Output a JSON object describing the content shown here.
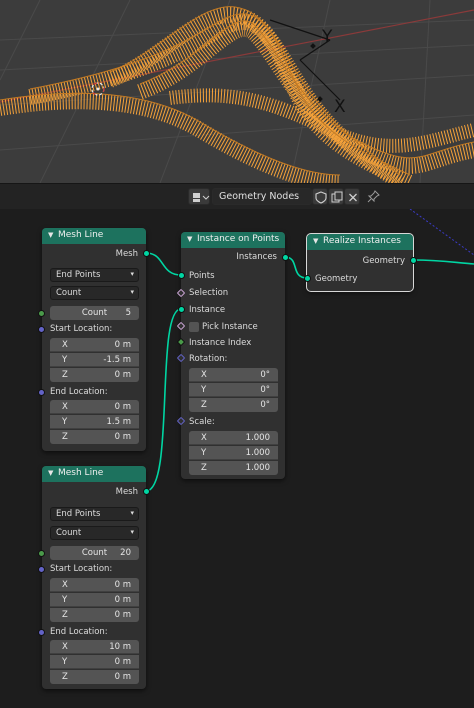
{
  "header": {
    "editor_icon": "node-editor-icon",
    "node_tree_name": "Geometry Nodes",
    "buttons": [
      "shield-icon",
      "duplicate-icon",
      "close-icon",
      "pin-icon"
    ]
  },
  "nodes": {
    "mesh_line_1": {
      "title": "Mesh Line",
      "output": "Mesh",
      "mode": "End Points",
      "count_mode": "Count",
      "count_label": "Count",
      "count_value": "5",
      "start_label": "Start Location:",
      "start": [
        {
          "axis": "X",
          "value": "0 m"
        },
        {
          "axis": "Y",
          "value": "-1.5 m"
        },
        {
          "axis": "Z",
          "value": "0 m"
        }
      ],
      "end_label": "End Location:",
      "end": [
        {
          "axis": "X",
          "value": "0 m"
        },
        {
          "axis": "Y",
          "value": "1.5 m"
        },
        {
          "axis": "Z",
          "value": "0 m"
        }
      ]
    },
    "mesh_line_2": {
      "title": "Mesh Line",
      "output": "Mesh",
      "mode": "End Points",
      "count_mode": "Count",
      "count_label": "Count",
      "count_value": "20",
      "start_label": "Start Location:",
      "start": [
        {
          "axis": "X",
          "value": "0 m"
        },
        {
          "axis": "Y",
          "value": "0 m"
        },
        {
          "axis": "Z",
          "value": "0 m"
        }
      ],
      "end_label": "End Location:",
      "end": [
        {
          "axis": "X",
          "value": "10 m"
        },
        {
          "axis": "Y",
          "value": "0 m"
        },
        {
          "axis": "Z",
          "value": "0 m"
        }
      ]
    },
    "instance_on_points": {
      "title": "Instance on Points",
      "output": "Instances",
      "points": "Points",
      "selection": "Selection",
      "instance": "Instance",
      "pick_instance": "Pick Instance",
      "instance_index": "Instance Index",
      "rotation_label": "Rotation:",
      "rotation": [
        {
          "axis": "X",
          "value": "0°"
        },
        {
          "axis": "Y",
          "value": "0°"
        },
        {
          "axis": "Z",
          "value": "0°"
        }
      ],
      "scale_label": "Scale:",
      "scale": [
        {
          "axis": "X",
          "value": "1.000"
        },
        {
          "axis": "Y",
          "value": "1.000"
        },
        {
          "axis": "Z",
          "value": "1.000"
        }
      ]
    },
    "realize_instances": {
      "title": "Realize Instances",
      "output": "Geometry",
      "input": "Geometry"
    }
  },
  "viewport": {
    "gizmo_labels": [
      "Y",
      "X"
    ],
    "mesh_color": "#f5a23a"
  },
  "colors": {
    "node_header": "#1d725e",
    "geometry_socket": "#00d6a3",
    "vector_socket": "#6363c7",
    "integer_socket": "#4a9a4a",
    "link": "#00d6a3"
  }
}
